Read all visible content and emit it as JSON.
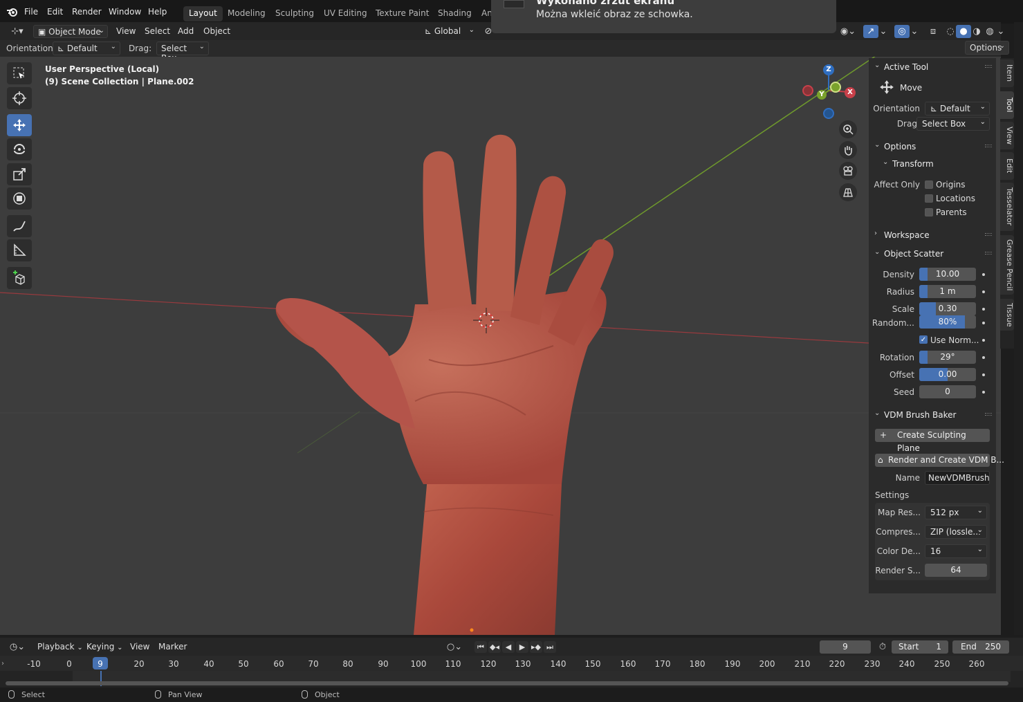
{
  "menubar": {
    "items": [
      "File",
      "Edit",
      "Render",
      "Window",
      "Help"
    ],
    "workspaces": [
      "Layout",
      "Modeling",
      "Sculpting",
      "UV Editing",
      "Texture Paint",
      "Shading",
      "An"
    ],
    "active_workspace": "Layout"
  },
  "notification": {
    "title": "Wykonano zrzut ekranu",
    "message": "Można wkleić obraz ze schowka."
  },
  "viewport_header": {
    "mode": "Object Mode",
    "menus": [
      "View",
      "Select",
      "Add",
      "Object"
    ],
    "transform_orientation": "Global"
  },
  "tool_settings": {
    "orientation_label": "Orientation:",
    "orientation_value": "Default",
    "drag_label": "Drag:",
    "drag_value": "Select Box",
    "options_label": "Options"
  },
  "viewport": {
    "title_line1": "User Perspective (Local)",
    "title_line2": "(9) Scene Collection | Plane.002",
    "axes": {
      "x": "X",
      "y": "Y",
      "z": "Z"
    }
  },
  "npanel": {
    "active_tool_header": "Active Tool",
    "tool_name": "Move",
    "orientation_label": "Orientation",
    "orientation_value": "Default",
    "drag_label": "Drag:",
    "drag_value": "Select Box",
    "options_header": "Options",
    "transform_header": "Transform",
    "affect_only_label": "Affect Only",
    "affect_only": [
      "Origins",
      "Locations",
      "Parents"
    ],
    "workspace_header": "Workspace",
    "object_scatter_header": "Object Scatter",
    "scatter": {
      "density_label": "Density",
      "density": "10.00",
      "density_fill": 0.08,
      "radius_label": "Radius",
      "radius": "1 m",
      "radius_fill": 0.08,
      "scale_label": "Scale",
      "scale": "0.30",
      "scale_fill": 0.3,
      "random_label": "Random...",
      "random": "80%",
      "random_fill": 0.8,
      "use_normal_label": "Use Norm...",
      "use_normal": true,
      "rotation_label": "Rotation",
      "rotation": "29°",
      "rotation_fill": 0.08,
      "offset_label": "Offset",
      "offset": "0.00",
      "offset_fill": 0.5,
      "seed_label": "Seed",
      "seed": "0"
    },
    "vdm_header": "VDM Brush Baker",
    "create_plane_button": "Create Sculpting Plane",
    "render_vdm_button": "Render and Create VDM B...",
    "name_label": "Name",
    "name_value": "NewVDMBrush",
    "settings_label": "Settings",
    "settings": {
      "map_res_label": "Map Res...",
      "map_res": "512 px",
      "compress_label": "Compres...",
      "compress": "ZIP (lossle...",
      "color_depth_label": "Color De...",
      "color_depth": "16",
      "render_samples_label": "Render S...",
      "render_samples": "64"
    }
  },
  "vertical_tabs": [
    "Item",
    "Tool",
    "View",
    "Edit",
    "Tesselator",
    "Grease Pencil",
    "Tissue"
  ],
  "active_vertical_tab": "Tool",
  "timeline": {
    "menus": [
      "Playback",
      "Keying",
      "View",
      "Marker"
    ],
    "current_frame": "9",
    "start_label": "Start",
    "start": "1",
    "end_label": "End",
    "end": "250",
    "ticks": [
      "-10",
      "0",
      "9",
      "20",
      "30",
      "40",
      "50",
      "60",
      "70",
      "80",
      "90",
      "100",
      "110",
      "120",
      "130",
      "140",
      "150",
      "160",
      "170",
      "180",
      "190",
      "200",
      "210",
      "220",
      "230",
      "240",
      "250",
      "260"
    ]
  },
  "statusbar": {
    "left": "Select",
    "middle": "Pan View",
    "right": "Object"
  },
  "colors": {
    "accent": "#4772b3",
    "viewport_bg": "#3d3d3d",
    "skin": "#b65646",
    "x_axis": "#c8404a",
    "y_axis": "#7aa22c",
    "z_axis": "#2f6ec1"
  }
}
